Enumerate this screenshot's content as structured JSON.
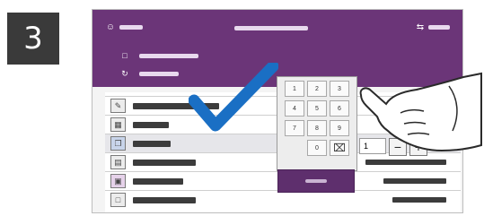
{
  "step": {
    "number": "3"
  },
  "keypad": {
    "keys": [
      "1",
      "2",
      "3",
      "4",
      "5",
      "6",
      "7",
      "8",
      "9",
      "",
      "0",
      ""
    ],
    "clear_icon": "backspace-icon"
  },
  "quantity": {
    "value": "1",
    "minus_label": "−",
    "plus_label": "+"
  },
  "icons": {
    "check": "checkmark-icon",
    "hand": "pointing-hand-icon",
    "user": "user-icon",
    "settings": "settings-icon"
  },
  "colors": {
    "header": "#6b3578",
    "accent_check": "#1a6fc4",
    "go_button": "#5e2f6d"
  }
}
